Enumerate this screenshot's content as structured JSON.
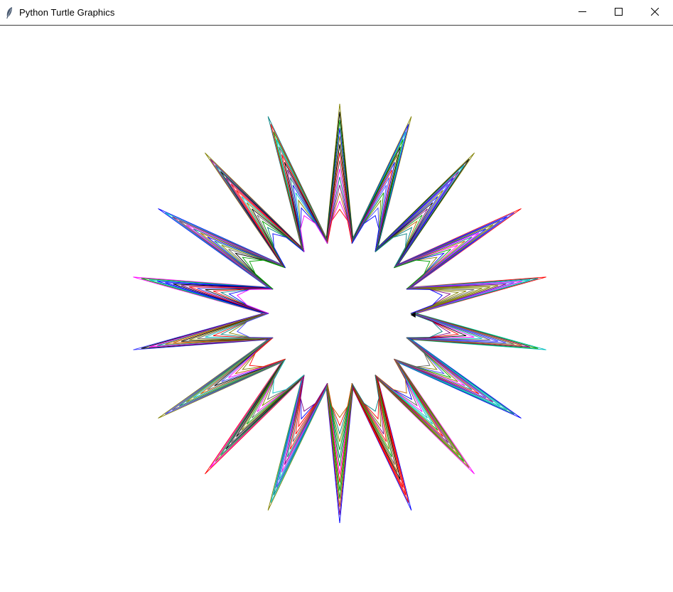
{
  "window": {
    "title": "Python Turtle Graphics",
    "icon": "feather-icon"
  },
  "controls": {
    "minimize_icon": "minimize-icon",
    "maximize_icon": "maximize-icon",
    "close_icon": "close-icon"
  },
  "drawing": {
    "background": "#ffffff",
    "spike_count": 18,
    "line_colors": [
      "#ff0000",
      "#00a000",
      "#0000ff",
      "#800080",
      "#008080",
      "#808000",
      "#000000",
      "#ff00ff",
      "#00c0c0",
      "#c06000",
      "#606060",
      "#4040ff"
    ]
  }
}
